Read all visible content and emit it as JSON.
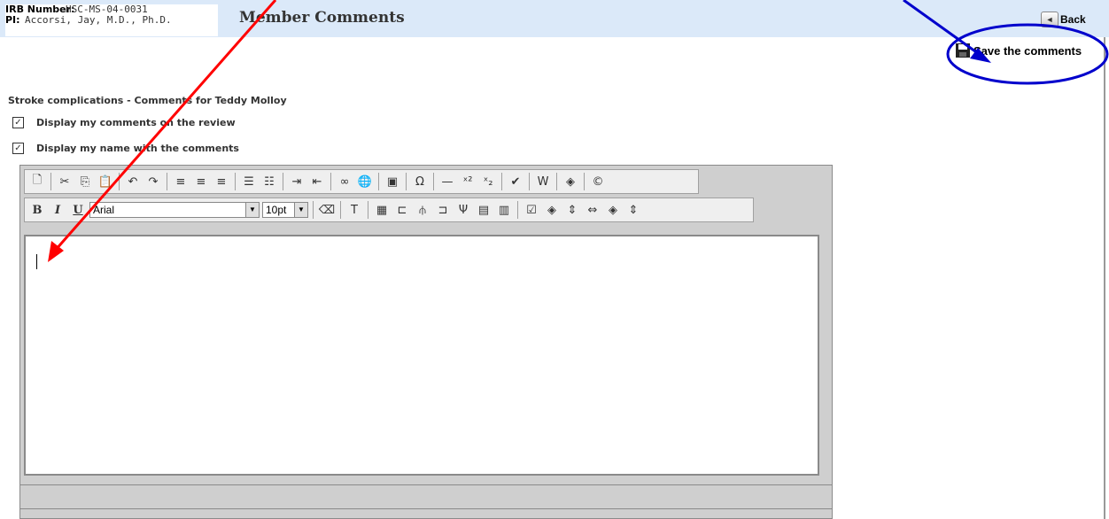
{
  "header": {
    "irb_label": "IRB Number:",
    "irb_value": "HSC-MS-04-0031",
    "pi_label": "PI:",
    "pi_value": "Accorsi, Jay, M.D., Ph.D.",
    "title": "Member Comments",
    "back_label": "Back",
    "save_label": "Save the comments"
  },
  "section": {
    "title": "Stroke complications - Comments for Teddy Molloy"
  },
  "options": [
    {
      "label": "Display my comments on the review",
      "checked": true
    },
    {
      "label": "Display my name with the comments",
      "checked": true
    }
  ],
  "editor": {
    "font_value": "Arial",
    "size_value": "10pt",
    "toolbar1_icons": [
      "new-document-icon",
      "cut-icon",
      "copy-icon",
      "paste-icon",
      "undo-icon",
      "redo-icon",
      "align-left-icon",
      "align-center-icon",
      "align-right-icon",
      "ordered-list-icon",
      "unordered-list-icon",
      "indent-icon",
      "outdent-icon",
      "link-icon",
      "hyperlink-icon",
      "image-icon",
      "special-char-icon",
      "horizontal-rule-icon",
      "superscript-icon",
      "subscript-icon",
      "spellcheck-icon",
      "word-paste-icon",
      "style-icon",
      "copyright-icon"
    ],
    "toolbar2_icons": [
      "bold-icon",
      "italic-icon",
      "underline-icon",
      "font-select",
      "size-select",
      "eraser-icon",
      "text-color-icon",
      "table-icon",
      "insert-row-icon",
      "split-cell-icon",
      "insert-column-icon",
      "merge-cell-icon",
      "table-props-icon",
      "cell-props-icon",
      "properties-icon",
      "fill-icon",
      "row-height-icon",
      "column-width-icon",
      "fill-icon-2",
      "column-width-icon-2"
    ],
    "content": ""
  },
  "colors": {
    "header_bg": "#dbe9f9",
    "annotation_red": "#ff0000",
    "annotation_blue": "#0000cc"
  }
}
